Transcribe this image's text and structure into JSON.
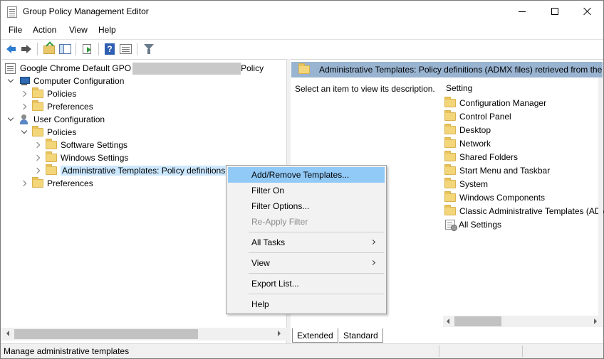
{
  "window": {
    "title": "Group Policy Management Editor"
  },
  "menubar": [
    "File",
    "Action",
    "View",
    "Help"
  ],
  "toolbar": {
    "icons": [
      "back-icon",
      "forward-icon",
      "up-folder-icon",
      "show-hide-tree-icon",
      "export-list-icon",
      "help-icon",
      "properties-icon",
      "filter-icon"
    ]
  },
  "tree": {
    "root_prefix": "Google Chrome Default GPO",
    "root_suffix": "Policy",
    "computer_config": "Computer Configuration",
    "cc_policies": "Policies",
    "cc_preferences": "Preferences",
    "user_config": "User Configuration",
    "uc_policies": "Policies",
    "software_settings": "Software Settings",
    "windows_settings": "Windows Settings",
    "admin_templates": "Administrative Templates: Policy definitions",
    "uc_preferences": "Preferences"
  },
  "right_pane": {
    "header": "Administrative Templates: Policy definitions (ADMX files) retrieved from the",
    "description": "Select an item to view its description.",
    "column_header": "Setting",
    "items": [
      "Configuration Manager",
      "Control Panel",
      "Desktop",
      "Network",
      "Shared Folders",
      "Start Menu and Taskbar",
      "System",
      "Windows Components",
      "Classic Administrative Templates (ADM",
      "All Settings"
    ]
  },
  "tabs": [
    "Extended",
    "Standard"
  ],
  "context_menu": {
    "add_remove": "Add/Remove Templates...",
    "filter_on": "Filter On",
    "filter_options": "Filter Options...",
    "reapply": "Re-Apply Filter",
    "all_tasks": "All Tasks",
    "view": "View",
    "export_list": "Export List...",
    "help": "Help"
  },
  "status": {
    "text": "Manage administrative templates"
  },
  "colors": {
    "header_band": "#99b4d1",
    "menu_hover": "#91c9f7",
    "selection": "#cce8ff",
    "folder": "#f3d57a"
  }
}
